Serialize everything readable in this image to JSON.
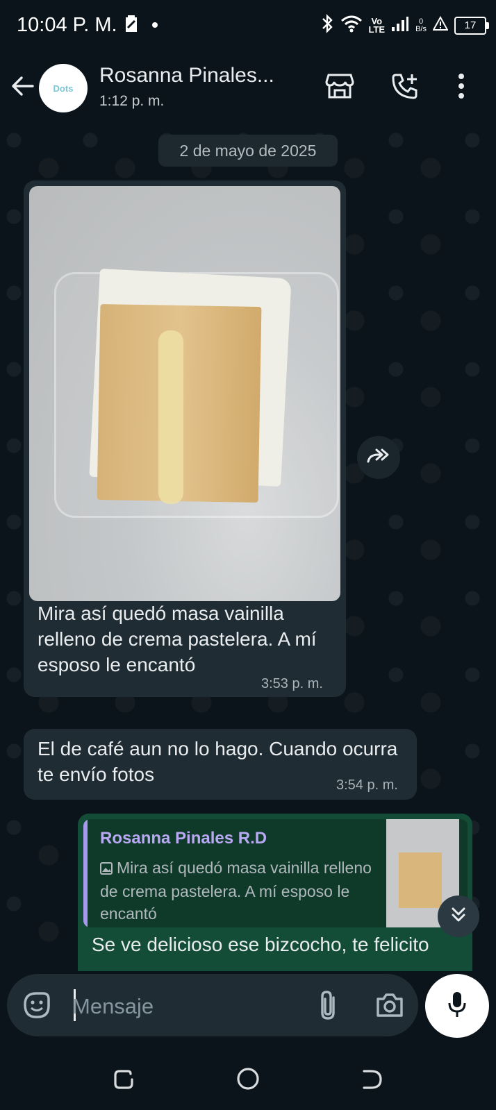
{
  "status_bar": {
    "time": "10:04 P. M.",
    "net_line1": "Vo",
    "net_line2": "LTE",
    "speed_value": "0",
    "speed_unit": "B/s",
    "battery": "17"
  },
  "header": {
    "contact_name": "Rosanna Pinales...",
    "subtitle": "1:12 p. m.",
    "avatar_text": "Dots"
  },
  "chat": {
    "date_chip": "2 de mayo de 2025",
    "messages": [
      {
        "text": "Mira así quedó masa vainilla relleno de crema pastelera. A mí esposo le encantó",
        "time": "3:53 p. m."
      },
      {
        "text": "El de café aun no lo hago. Cuando ocurra te envío fotos",
        "time": "3:54 p. m."
      },
      {
        "quote_author": "Rosanna Pinales R.D",
        "quote_text": "Mira así quedó masa vainilla relleno de crema pastelera. A mí esposo le encantó",
        "text": "Se ve delicioso ese bizcocho, te felicito"
      }
    ]
  },
  "input": {
    "placeholder": "Mensaje"
  },
  "colors": {
    "background": "#0b141a",
    "incoming_bubble": "#202c33",
    "outgoing_bubble": "#144d37",
    "quote_accent": "#a899f0"
  }
}
